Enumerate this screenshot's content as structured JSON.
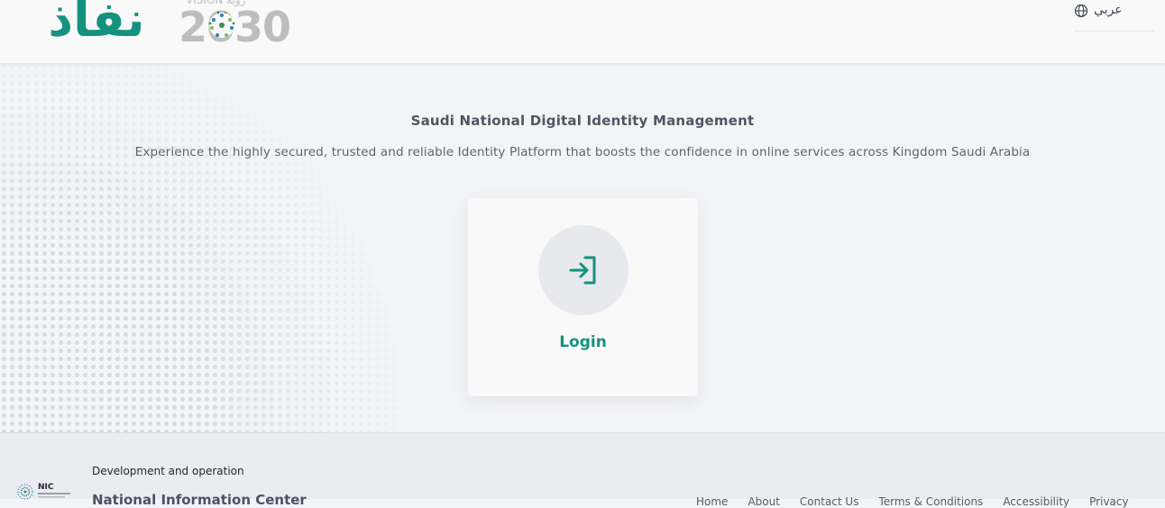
{
  "header": {
    "logo_text": "نفاذ",
    "vision_logo": {
      "top_text": "VISION رؤية",
      "year_text": "2030"
    },
    "language": {
      "label": "عربي",
      "icon": "globe-icon"
    }
  },
  "hero": {
    "title": "Saudi National Digital Identity Management",
    "subtitle": "Experience the highly secured, trusted and reliable Identity Platform that boosts the confidence in online services across Kingdom Saudi Arabia"
  },
  "login_card": {
    "label": "Login",
    "icon": "login-icon"
  },
  "footer": {
    "logo_text": "NIC",
    "development_label": "Development and operation",
    "organization": "National Information Center",
    "links": [
      "Home",
      "About",
      "Contact Us",
      "Terms & Conditions",
      "Accessibility",
      "Privacy"
    ]
  },
  "colors": {
    "brand_green": "#15927e",
    "text_dark": "#4f5663",
    "background": "#f3f4f8",
    "header_background": "#f9f9fa"
  }
}
